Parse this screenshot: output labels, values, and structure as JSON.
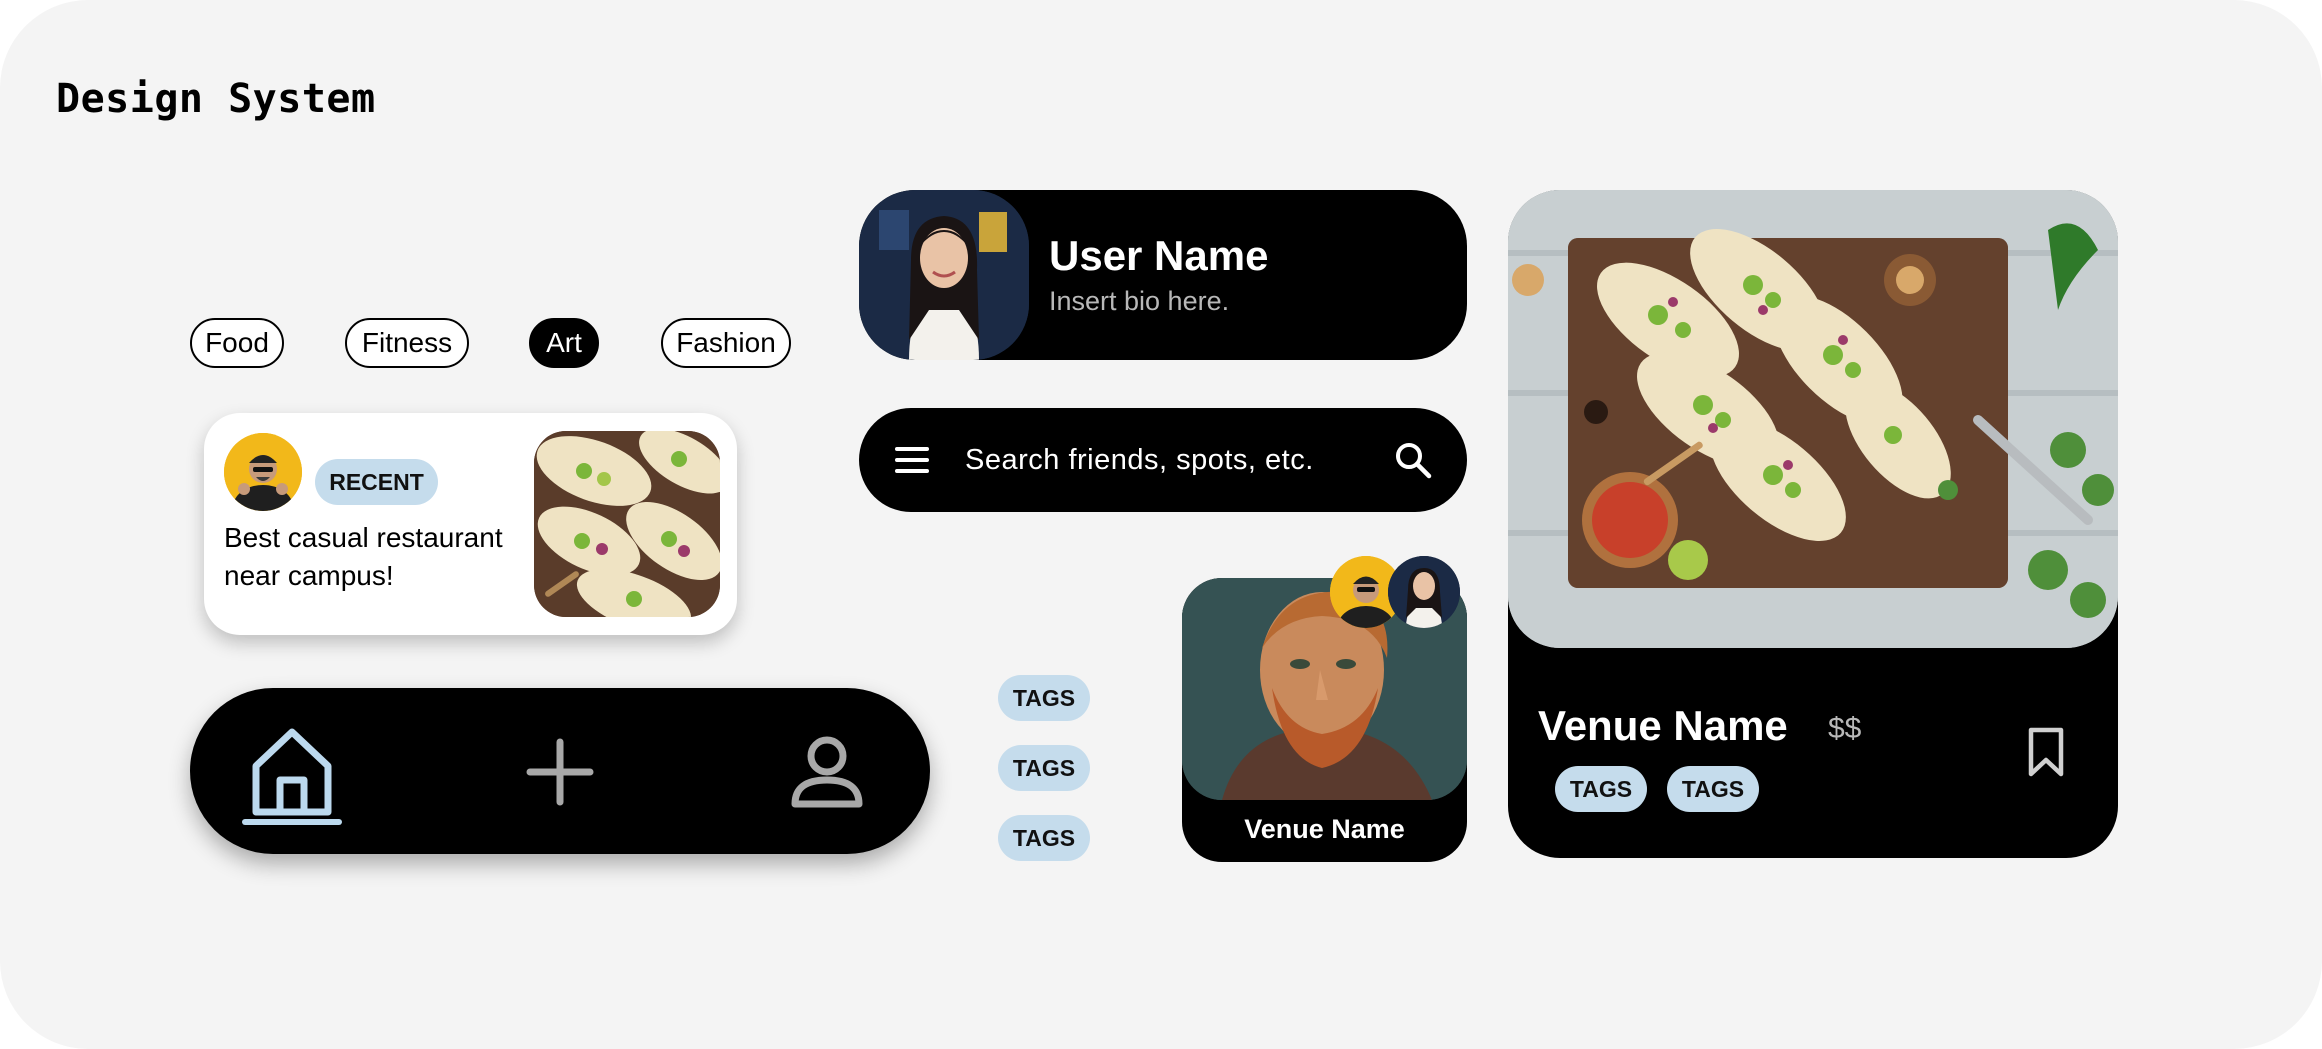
{
  "page": {
    "title": "Design System"
  },
  "chips": [
    {
      "label": "Food",
      "active": false
    },
    {
      "label": "Fitness",
      "active": false
    },
    {
      "label": "Art",
      "active": true
    },
    {
      "label": "Fashion",
      "active": false
    }
  ],
  "post_card": {
    "badge": "RECENT",
    "text": "Best casual restaurant near campus!"
  },
  "navbar": {
    "items": [
      {
        "icon": "home-icon",
        "active": true
      },
      {
        "icon": "plus-icon",
        "active": false
      },
      {
        "icon": "user-icon",
        "active": false
      }
    ]
  },
  "profile": {
    "name": "User Name",
    "bio": "Insert bio here."
  },
  "search": {
    "placeholder": "Search friends, spots, etc.",
    "menu_icon": "menu-icon",
    "search_icon": "search-icon"
  },
  "tags": [
    "TAGS",
    "TAGS",
    "TAGS"
  ],
  "venue_small": {
    "name": "Venue Name"
  },
  "venue_large": {
    "name": "Venue Name",
    "price": "$$",
    "tags": [
      "TAGS",
      "TAGS"
    ],
    "bookmark_icon": "bookmark-icon"
  },
  "colors": {
    "background": "#f4f4f4",
    "card_dark": "#000000",
    "tag_blue": "#c5dcec",
    "accent_light_blue": "#bcd9ee",
    "avatar_yellow": "#f2b81a"
  }
}
